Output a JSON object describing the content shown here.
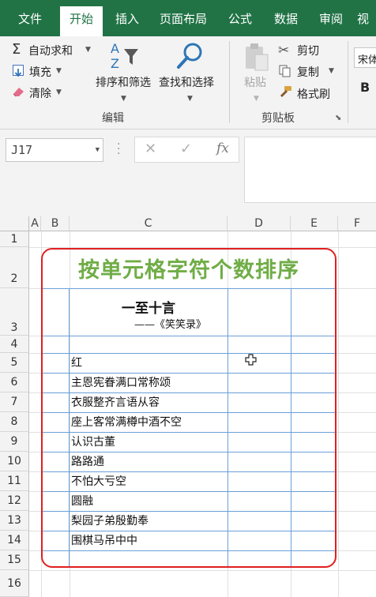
{
  "tabs": [
    "文件",
    "开始",
    "插入",
    "页面布局",
    "公式",
    "数据",
    "审阅",
    "视"
  ],
  "active_tab": "开始",
  "ribbon": {
    "editing": {
      "autosum": "自动求和",
      "fill": "填充",
      "clear": "清除",
      "sort_filter": "排序和筛选",
      "find_select": "查找和选择",
      "group_label": "编辑"
    },
    "clipboard": {
      "paste": "粘贴",
      "cut": "剪切",
      "copy": "复制",
      "format_painter": "格式刷",
      "group_label": "剪贴板"
    },
    "font": {
      "name": "宋体",
      "bold": "B"
    }
  },
  "formula_bar": {
    "name_box": "J17",
    "fx_label": "fx",
    "formula": ""
  },
  "columns": [
    "A",
    "B",
    "C",
    "D",
    "E",
    "F"
  ],
  "rows": [
    "1",
    "2",
    "3",
    "4",
    "5",
    "6",
    "7",
    "8",
    "9",
    "10",
    "11",
    "12",
    "13",
    "14",
    "15",
    "16"
  ],
  "sheet": {
    "title": "按单元格字符个数排序",
    "poem_title": "一至十言",
    "poem_subtitle": "——《笑笑录》",
    "items": [
      "红",
      "主恩宪眷满口常称颂",
      "衣服整齐言语从容",
      "座上客常满樽中酒不空",
      "认识古董",
      "路路通",
      "不怕大亏空",
      "圆融",
      "梨园子弟殷勤奉",
      "围棋马吊中中"
    ]
  },
  "colors": {
    "excel_green": "#217346",
    "title_green": "#70ad47",
    "frame_red": "#e02020",
    "border_blue": "#6a9fd8"
  }
}
